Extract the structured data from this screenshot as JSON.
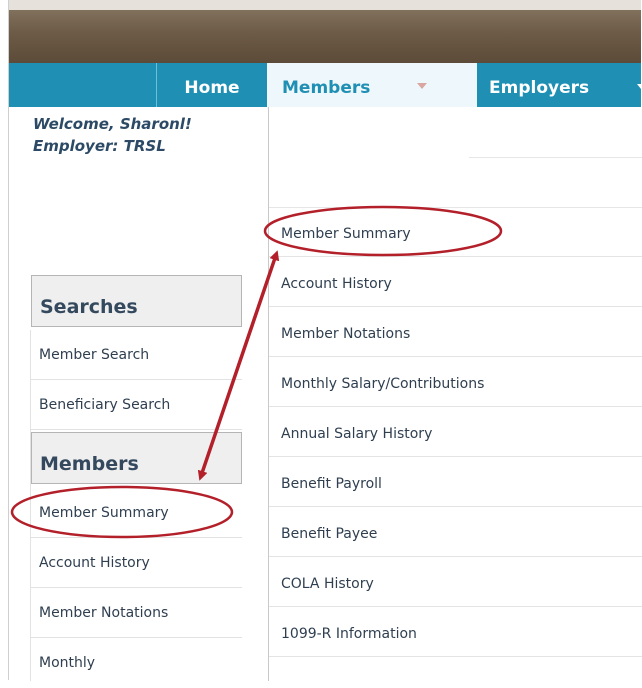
{
  "nav": {
    "home": "Home",
    "members": "Members",
    "employers": "Employers"
  },
  "welcome": {
    "line1": "Welcome, Sharonl!",
    "line2": "Employer: TRSL"
  },
  "sidebar": {
    "searches_heading": "Searches",
    "searches": [
      "Member Search",
      "Beneficiary Search"
    ],
    "members_heading": "Members",
    "members": [
      "Member Summary",
      "Account History",
      "Member Notations",
      "Monthly"
    ]
  },
  "members_menu": {
    "items": [
      "Member Summary",
      "Account History",
      "Member Notations",
      "Monthly Salary/Contributions",
      "Annual Salary History",
      "Benefit Payroll",
      "Benefit Payee",
      "COLA History",
      "1099-R Information"
    ]
  },
  "colors": {
    "nav_blue": "#1f8fb4",
    "annotation_red": "#b3202a"
  }
}
